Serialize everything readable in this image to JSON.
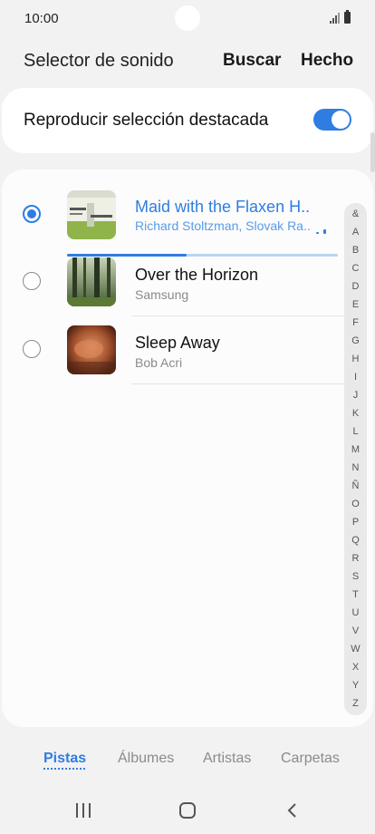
{
  "status": {
    "time": "10:00"
  },
  "header": {
    "title": "Selector de sonido",
    "search_label": "Buscar",
    "done_label": "Hecho"
  },
  "highlight": {
    "label": "Reproducir selección destacada",
    "enabled": true
  },
  "tracks": [
    {
      "title": "Maid with the Flaxen H..",
      "artist": "Richard Stoltzman, Slovak Ra..",
      "selected": true,
      "playing": true,
      "progress": 0.44
    },
    {
      "title": "Over the Horizon",
      "artist": "Samsung",
      "selected": false
    },
    {
      "title": "Sleep Away",
      "artist": "Bob Acri",
      "selected": false
    }
  ],
  "index_letters": [
    "&",
    "A",
    "B",
    "C",
    "D",
    "E",
    "F",
    "G",
    "H",
    "I",
    "J",
    "K",
    "L",
    "M",
    "N",
    "Ñ",
    "O",
    "P",
    "Q",
    "R",
    "S",
    "T",
    "U",
    "V",
    "W",
    "X",
    "Y",
    "Z"
  ],
  "tabs": [
    {
      "label": "Pistas",
      "active": true
    },
    {
      "label": "Álbumes",
      "active": false
    },
    {
      "label": "Artistas",
      "active": false
    },
    {
      "label": "Carpetas",
      "active": false
    }
  ],
  "icons": {
    "album_art": [
      "album-art-icon",
      "forest-art-icon",
      "abstract-art-icon"
    ],
    "navigation": [
      "recent-apps-icon",
      "home-icon",
      "back-icon"
    ]
  },
  "colors": {
    "accent": "#2f7de1",
    "background": "#f2f2f2",
    "card": "#ffffff"
  }
}
